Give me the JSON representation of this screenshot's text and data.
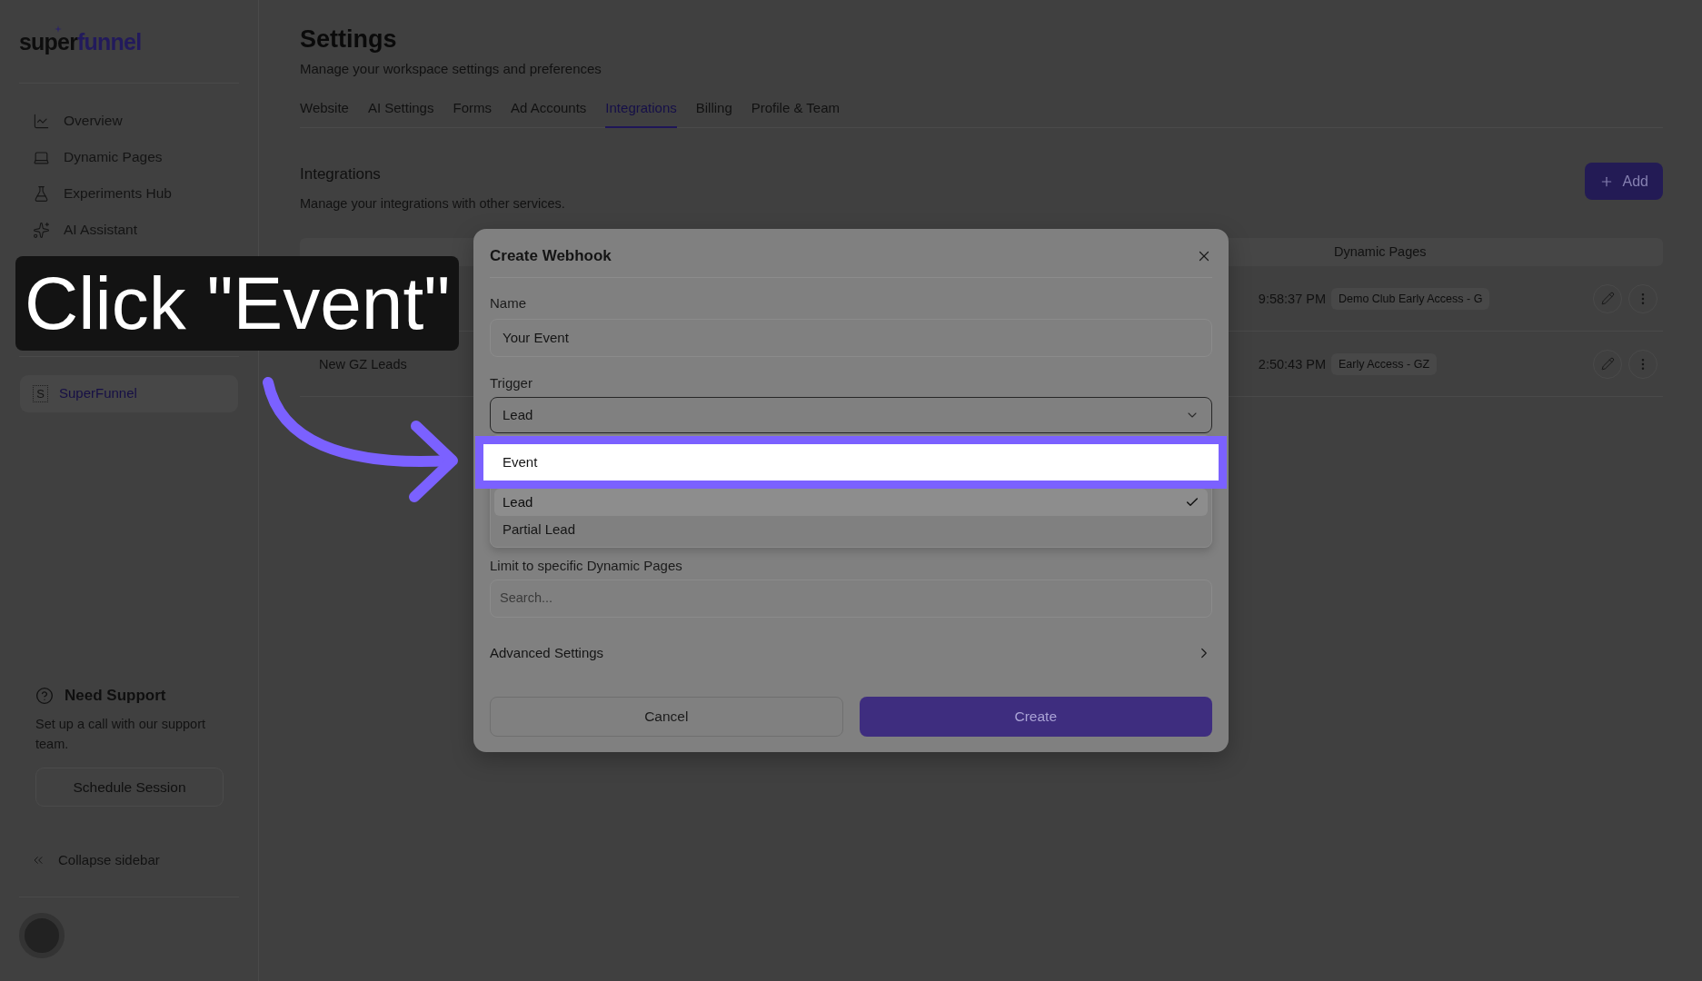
{
  "callout": {
    "text": "Click \"Event\""
  },
  "sidebar": {
    "logo": {
      "part_1": "super",
      "part_2": "funnel"
    },
    "nav_items": [
      {
        "label": "Overview"
      },
      {
        "label": "Dynamic Pages"
      },
      {
        "label": "Experiments Hub"
      },
      {
        "label": "AI Assistant"
      }
    ],
    "workspace": {
      "initial": "S",
      "name": "SuperFunnel"
    },
    "support": {
      "title": "Need Support",
      "description": "Set up a call with our support team.",
      "button": "Schedule Session"
    },
    "collapse": "Collapse sidebar"
  },
  "header": {
    "title": "Settings",
    "subtitle": "Manage your workspace settings and preferences"
  },
  "tabs": [
    {
      "label": "Website",
      "selected": false
    },
    {
      "label": "AI Settings",
      "selected": false
    },
    {
      "label": "Forms",
      "selected": false
    },
    {
      "label": "Ad Accounts",
      "selected": false
    },
    {
      "label": "Integrations",
      "selected": true
    },
    {
      "label": "Billing",
      "selected": false
    },
    {
      "label": "Profile & Team",
      "selected": false
    }
  ],
  "integrations": {
    "title": "Integrations",
    "description": "Manage your integrations with other services.",
    "add_button": "Add",
    "table": {
      "dynamic_pages_header": "Dynamic Pages",
      "rows": [
        {
          "column_2": "9:58:37 PM",
          "dynamic_pages": "Demo Club Early Access - G"
        },
        {
          "column_1": "New GZ Leads",
          "column_2": "2:50:43 PM",
          "dynamic_pages": "Early Access - GZ"
        }
      ]
    }
  },
  "modal": {
    "title": "Create Webhook",
    "name_label": "Name",
    "name_value": "Your Event",
    "trigger_label": "Trigger",
    "trigger_value": "Lead",
    "trigger_options": [
      {
        "label": "Event",
        "selected": false,
        "highlighted": true
      },
      {
        "label": "Lead",
        "selected": true,
        "highlighted": false
      },
      {
        "label": "Partial Lead",
        "selected": false,
        "highlighted": false
      }
    ],
    "pages_label": "Limit to specific Dynamic Pages",
    "pages_placeholder": "Search...",
    "advanced": "Advanced Settings",
    "cancel": "Cancel",
    "create": "Create"
  }
}
